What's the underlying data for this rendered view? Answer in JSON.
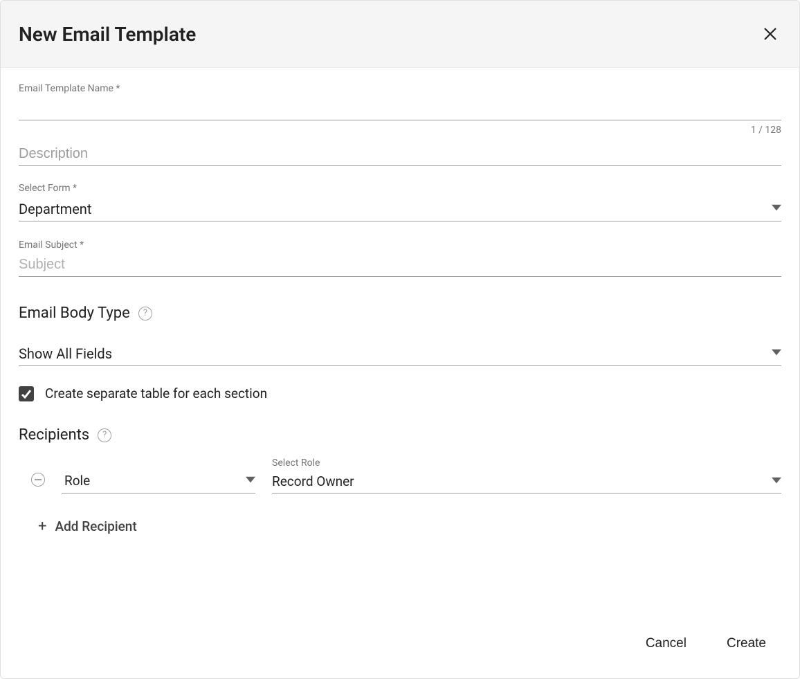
{
  "dialog": {
    "title": "New Email Template"
  },
  "fields": {
    "templateName": {
      "label": "Email Template Name *",
      "value": "",
      "counter": "1 / 128"
    },
    "description": {
      "placeholder": "Description",
      "value": ""
    },
    "selectForm": {
      "label": "Select Form *",
      "value": "Department"
    },
    "emailSubject": {
      "label": "Email Subject *",
      "placeholder": "Subject",
      "value": ""
    }
  },
  "emailBody": {
    "heading": "Email Body Type",
    "showAllValue": "Show All Fields",
    "separateTableLabel": "Create separate table for each section",
    "separateTableChecked": true
  },
  "recipients": {
    "heading": "Recipients",
    "row": {
      "typeValue": "Role",
      "roleLabel": "Select Role",
      "roleValue": "Record Owner"
    },
    "addLabel": "Add Recipient"
  },
  "footer": {
    "cancel": "Cancel",
    "create": "Create"
  }
}
